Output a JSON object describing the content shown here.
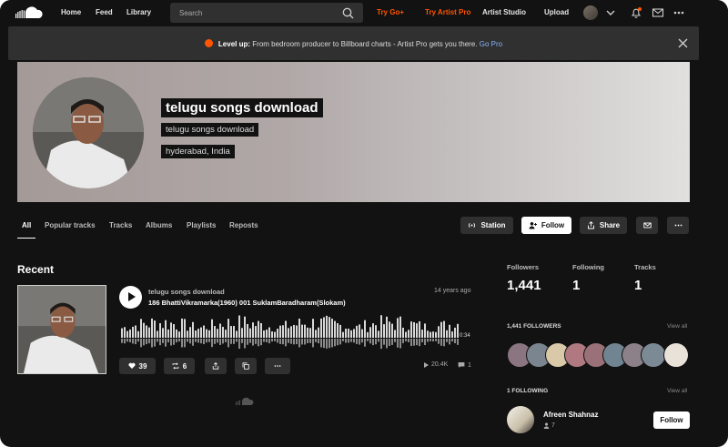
{
  "nav": {
    "home": "Home",
    "feed": "Feed",
    "library": "Library",
    "search_placeholder": "Search",
    "try_go": "Try Go+",
    "try_artist": "Try Artist Pro",
    "artist_studio": "Artist Studio",
    "upload": "Upload"
  },
  "banner": {
    "lead": "Level up:",
    "text": " From bedroom producer to Billboard charts - Artist Pro gets you there. ",
    "link": "Go Pro"
  },
  "profile": {
    "name": "telugu songs download",
    "subname": "telugu songs download",
    "location": "hyderabad, India"
  },
  "tabs": [
    "All",
    "Popular tracks",
    "Tracks",
    "Albums",
    "Playlists",
    "Reposts"
  ],
  "profile_actions": {
    "station": "Station",
    "follow": "Follow",
    "share": "Share"
  },
  "recent": {
    "heading": "Recent",
    "uploader": "telugu songs download",
    "time": "14 years ago",
    "title": "186 BhattiVikramarka(1960) 001 SuklamBaradharam(Slokam)",
    "duration": "0:34",
    "likes": "39",
    "reposts": "6",
    "plays": "20.4K",
    "comments": "1"
  },
  "stats": {
    "followers_label": "Followers",
    "followers": "1,441",
    "following_label": "Following",
    "following": "1",
    "tracks_label": "Tracks",
    "tracks": "1"
  },
  "followers_section": {
    "title": "1,441 FOLLOWERS",
    "view_all": "View all"
  },
  "following_section": {
    "title": "1 FOLLOWING",
    "view_all": "View all",
    "user_name": "Afreen Shahnaz",
    "user_followers": "7",
    "follow": "Follow"
  },
  "colors": {
    "accent": "#ff5500",
    "background": "#121212",
    "surface": "#303030",
    "link": "#8ab4ff"
  }
}
